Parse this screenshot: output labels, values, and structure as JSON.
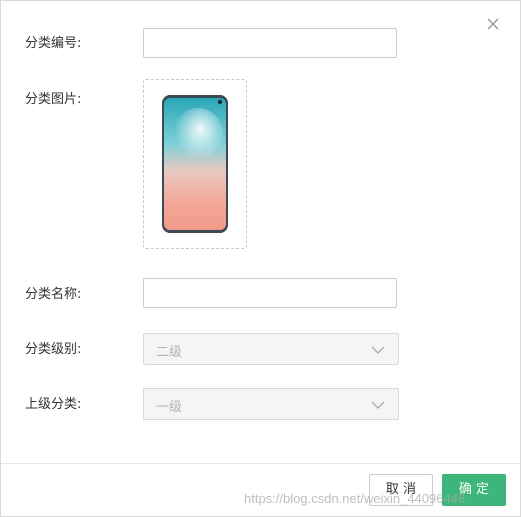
{
  "dialog": {
    "close_icon": "close-icon"
  },
  "form": {
    "category_code": {
      "label": "分类编号:",
      "value": ""
    },
    "category_image": {
      "label": "分类图片:",
      "image": "phone-image"
    },
    "category_name": {
      "label": "分类名称:",
      "value": ""
    },
    "category_level": {
      "label": "分类级别:",
      "selected": "二级",
      "disabled": true
    },
    "parent_category": {
      "label": "上级分类:",
      "selected": "一级",
      "disabled": true
    }
  },
  "footer": {
    "cancel_label": "取 消",
    "ok_label": "确 定"
  },
  "watermark": "https://blog.csdn.net/weixin_44096448",
  "colors": {
    "primary": "#3cb67a",
    "border": "#cccccc",
    "disabled_bg": "#f5f5f5"
  }
}
